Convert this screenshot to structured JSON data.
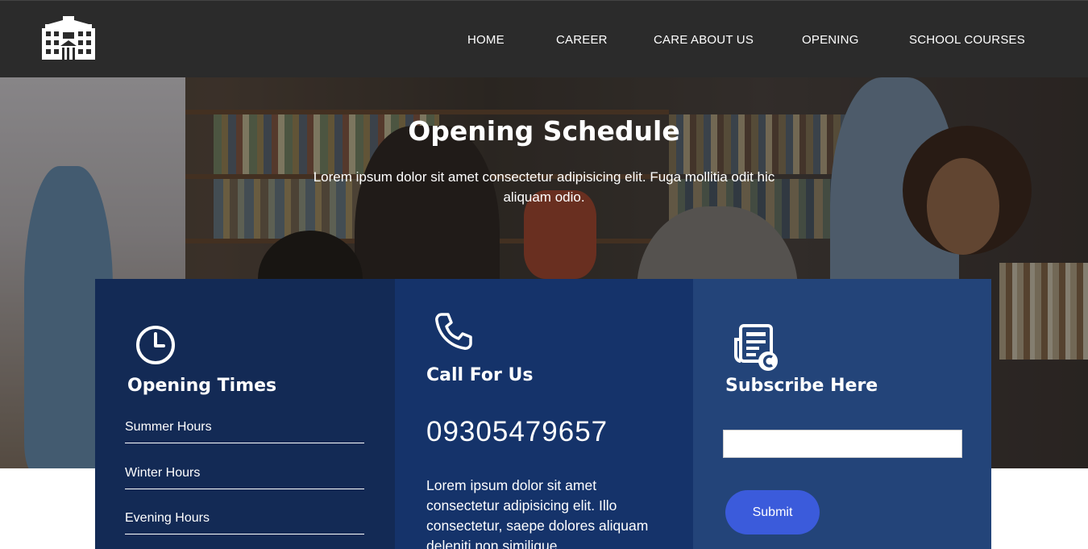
{
  "nav": {
    "logo_icon": "school-building-icon",
    "links": [
      "HOME",
      "CAREER",
      "CARE ABOUT US",
      "OPENING",
      "SCHOOL COURSES"
    ]
  },
  "hero": {
    "title": "Opening Schedule",
    "subtitle": "Lorem ipsum dolor sit amet consectetur adipisicing elit. Fuga mollitia odit hic aliquam odio."
  },
  "cards": {
    "opening": {
      "icon": "clock-icon",
      "title": "Opening Times",
      "items": [
        "Summer Hours",
        "Winter Hours",
        "Evening Hours"
      ]
    },
    "call": {
      "icon": "phone-icon",
      "title": "Call For Us",
      "phone": "09305479657",
      "description": "Lorem ipsum dolor sit amet consectetur adipisicing elit. Illo consectetur, saepe dolores aliquam deleniti non similique"
    },
    "subscribe": {
      "icon": "newsletter-icon",
      "title": "Subscribe Here",
      "input_value": "",
      "submit_label": "Submit"
    }
  },
  "colors": {
    "navbar": "#2b2b2b",
    "card_opening": "#132a55",
    "card_call": "#15336a",
    "card_subscribe": "#234479",
    "submit_button": "#3b5bdb"
  }
}
